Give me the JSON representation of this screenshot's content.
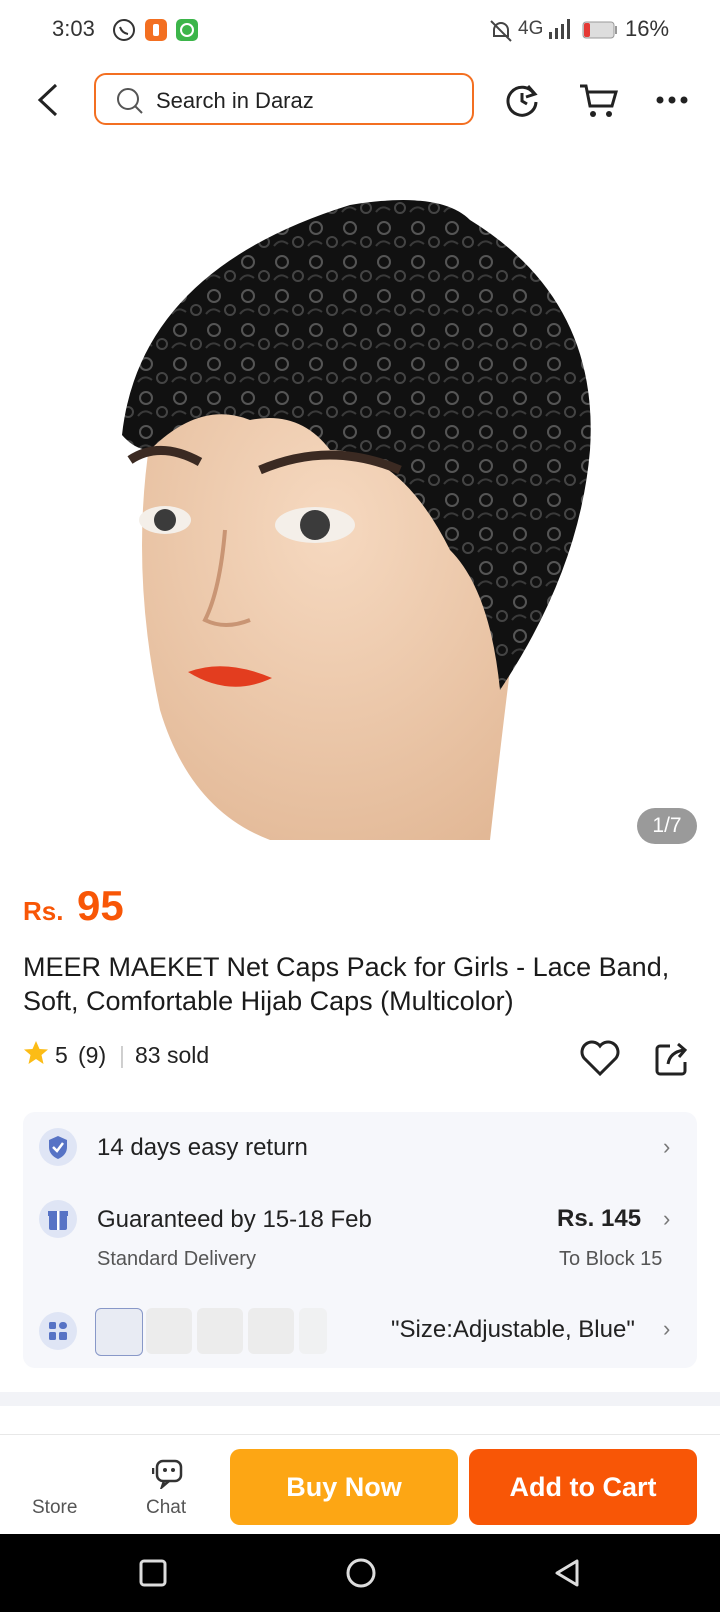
{
  "status_bar": {
    "time": "3:03",
    "network": "4G",
    "battery": "16%"
  },
  "header": {
    "search_placeholder": "Search in Daraz"
  },
  "gallery": {
    "counter": "1/7"
  },
  "product": {
    "currency": "Rs.",
    "price": "95",
    "title": "MEER MAEKET Net Caps Pack for Girls - Lace Band, Soft, Comfortable Hijab Caps (Multicolor)",
    "rating": "5",
    "reviews": "(9)",
    "sold": "83 sold"
  },
  "info": {
    "return_text": "14 days easy return",
    "delivery_text": "Guaranteed by 15-18 Feb",
    "delivery_sub": "Standard Delivery",
    "delivery_price": "Rs. 145",
    "delivery_location": "To Block 15",
    "variant_text": "\"Size:Adjustable, Blue\""
  },
  "bottom_bar": {
    "store_label": "Store",
    "chat_label": "Chat",
    "buy_now": "Buy Now",
    "add_to_cart": "Add to Cart",
    "buy_color": "#fda614",
    "cart_color": "#f85606"
  }
}
